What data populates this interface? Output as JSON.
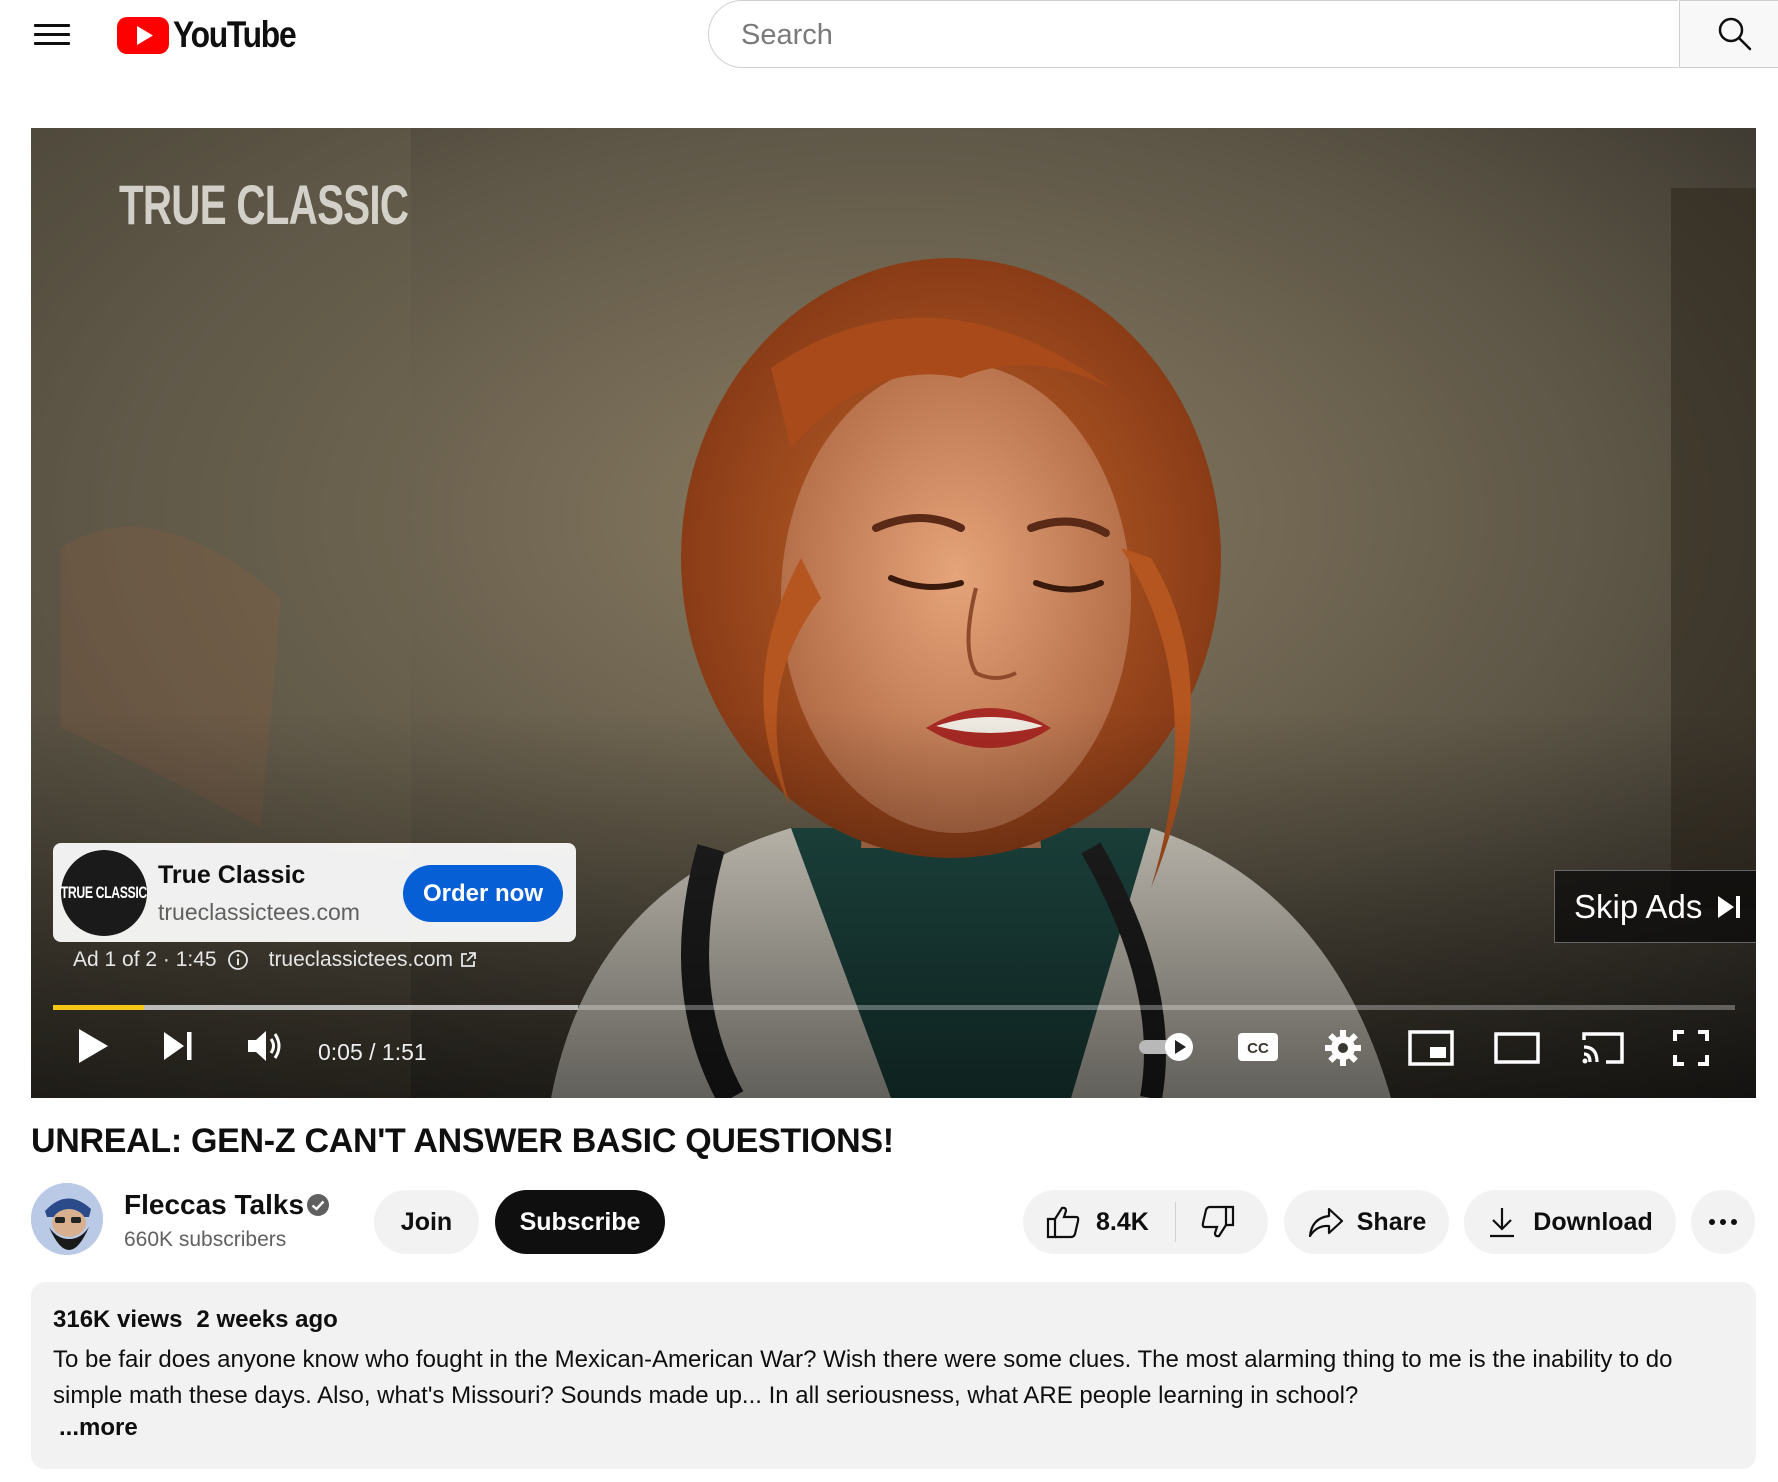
{
  "masthead": {
    "logo_text": "YouTube",
    "search_placeholder": "Search"
  },
  "player": {
    "watermark": "TRUE CLASSIC",
    "ad_card": {
      "avatar_text": "TRUE CLASSIC",
      "title": "True Classic",
      "url": "trueclassictees.com",
      "cta_label": "Order now"
    },
    "ad_info": {
      "position": "Ad 1 of 2",
      "remaining": "1:45",
      "link": "trueclassictees.com"
    },
    "skip_label": "Skip Ads",
    "progress": {
      "played": 0.054,
      "buffered": 0.312
    },
    "time": "0:05 / 1:51",
    "colors": {
      "progress_ad": "#f5c518"
    }
  },
  "video": {
    "title": "UNREAL: GEN-Z CAN'T ANSWER BASIC QUESTIONS!",
    "channel_name": "Fleccas Talks",
    "subscribers": "660K subscribers",
    "join_label": "Join",
    "subscribe_label": "Subscribe",
    "like_count": "8.4K",
    "share_label": "Share",
    "download_label": "Download"
  },
  "description": {
    "views": "316K views",
    "age": "2 weeks ago",
    "text": "To be fair does anyone know who fought in the Mexican-American War? Wish there were some clues. The most alarming thing to me is the inability to do simple math these days. Also, what's Missouri? Sounds made up... In all seriousness, what ARE people learning in school?",
    "more_label": "...more"
  },
  "icons": [
    "menu-icon",
    "youtube-play-icon",
    "search-icon",
    "info-icon",
    "external-link-icon",
    "skip-next-icon",
    "play-icon",
    "next-icon",
    "volume-icon",
    "autoplay-toggle-icon",
    "captions-icon",
    "settings-gear-icon",
    "miniplayer-icon",
    "theater-mode-icon",
    "cast-icon",
    "fullscreen-icon",
    "verified-icon",
    "thumbs-up-icon",
    "thumbs-down-icon",
    "share-arrow-icon",
    "download-icon",
    "more-horiz-icon"
  ]
}
